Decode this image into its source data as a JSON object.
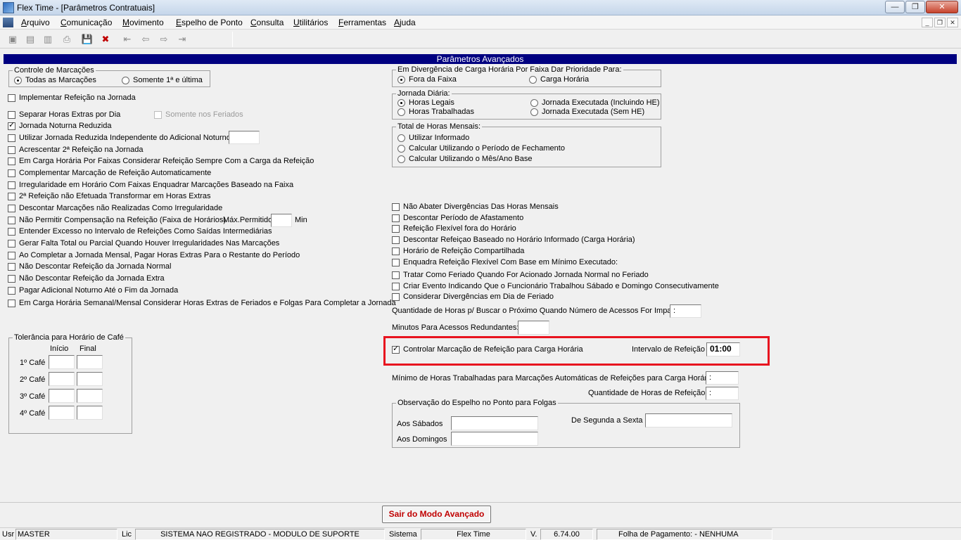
{
  "window": {
    "title": "Flex Time - [Parâmetros Contratuais]",
    "minimize": "—",
    "restore": "❐",
    "close": "✕"
  },
  "menu": {
    "items": [
      "Arquivo",
      "Comunicação",
      "Movimento",
      "Espelho de Ponto",
      "Consulta",
      "Utilitários",
      "Ferramentas",
      "Ajuda"
    ],
    "mdi_minimize": "_",
    "mdi_restore": "❐",
    "mdi_close": "✕"
  },
  "toolbar": {
    "icons": [
      "new-icon",
      "edit-icon",
      "copy-icon",
      "print-icon",
      "save-icon",
      "delete-icon",
      "first-icon",
      "previous-icon",
      "next-icon",
      "last-icon"
    ],
    "glyphs": [
      "▣",
      "▤",
      "▥",
      "⎙",
      "💾",
      "✖",
      "⇤",
      "⇦",
      "⇨",
      "⇥"
    ]
  },
  "header": {
    "title": "Parâmetros Avançados"
  },
  "controle_marcacoes": {
    "legend": "Controle de Marcações",
    "options": [
      "Todas as Marcações",
      "Somente 1ª e última"
    ],
    "selected": 0
  },
  "left_checks": [
    {
      "label": "Implementar Refeição na Jornada",
      "checked": false
    },
    {
      "label": "Separar Horas Extras por Dia",
      "checked": false
    },
    {
      "label": "Jornada Noturna Reduzida",
      "checked": true
    },
    {
      "label": "Utilizar Jornada Reduzida Independente do Adicional Noturno",
      "checked": false
    },
    {
      "label": "Acrescentar 2ª Refeição na Jornada",
      "checked": false
    },
    {
      "label": "Em Carga Horária Por Faixas Considerar Refeição Sempre Com a Carga da Refeição",
      "checked": false
    },
    {
      "label": "Complementar Marcação de Refeição Automaticamente",
      "checked": false
    },
    {
      "label": "Irregularidade em Horário Com Faixas Enquadrar Marcações Baseado na Faixa",
      "checked": false
    },
    {
      "label": "2ª Refeição não Efetuada Transformar em Horas Extras",
      "checked": false
    },
    {
      "label": "Descontar Marcações não Realizadas Como Irregularidade",
      "checked": false
    },
    {
      "label": "Não Permitir Compensação na Refeição (Faixa de Horários)",
      "checked": false
    },
    {
      "label": "Entender Excesso no Intervalo de Refeições Como Saídas Intermediárias",
      "checked": false
    },
    {
      "label": "Gerar Falta Total ou Parcial Quando Houver Irregularidades Nas Marcações",
      "checked": false
    },
    {
      "label": "Ao Completar a Jornada Mensal, Pagar Horas Extras Para o Restante do Período",
      "checked": false
    },
    {
      "label": "Não Descontar Refeição da Jornada Normal",
      "checked": false
    },
    {
      "label": "Não Descontar Refeição da Jornada Extra",
      "checked": false
    },
    {
      "label": "Pagar Adicional Noturno Até o Fim da Jornada",
      "checked": false
    },
    {
      "label": "Em Carga Horária Semanal/Mensal Considerar Horas Extras de Feriados e Folgas Para Completar a Jornada",
      "checked": false
    }
  ],
  "somente_feriados": {
    "label": "Somente nos Feriados",
    "checked": false
  },
  "max_permitido": {
    "label": "Máx.Permitido",
    "value": "",
    "unit": "Min"
  },
  "tolerancia_cafe": {
    "legend": "Tolerância para Horário de Café",
    "col_inicio": "Início",
    "col_final": "Final",
    "rows": [
      "1º Café",
      "2º Café",
      "3º Café",
      "4º Café"
    ]
  },
  "divergencia": {
    "legend": "Em Divergência de Carga Horária Por Faixa Dar Prioridade Para:",
    "options": [
      "Fora da Faixa",
      "Carga Horária"
    ],
    "selected": 0
  },
  "jornada_diaria": {
    "legend": "Jornada Diária:",
    "options": [
      "Horas Legais",
      "Horas Trabalhadas",
      "Jornada Executada (Incluindo HE)",
      "Jornada Executada (Sem HE)"
    ],
    "selected": 0
  },
  "total_horas_mensais": {
    "legend": "Total de Horas Mensais:",
    "options": [
      "Utilizar Informado",
      "Calcular Utilizando o Período de Fechamento",
      "Calcular Utilizando o Mês/Ano Base"
    ],
    "selected": -1
  },
  "right_checks": [
    {
      "label": "Não Abater Divergências Das Horas Mensais",
      "checked": false
    },
    {
      "label": "Descontar Período de Afastamento",
      "checked": false
    },
    {
      "label": "Refeição Flexível fora do Horário",
      "checked": false
    },
    {
      "label": "Descontar Refeiçao Baseado no Horário Informado (Carga Horária)",
      "checked": false
    },
    {
      "label": "Horário de Refeição Compartilhada",
      "checked": false
    },
    {
      "label": "Enquadra Refeição Flexível Com Base em Mínimo Executado:",
      "checked": false
    },
    {
      "label": "Tratar Como Feriado Quando For Acionado Jornada Normal no Feriado",
      "checked": false
    },
    {
      "label": "Criar Evento Indicando Que o Funcionário Trabalhou Sábado e Domingo Consecutivamente",
      "checked": false
    },
    {
      "label": "Considerar Divergências em Dia de Feriado",
      "checked": false
    }
  ],
  "quantidade_horas_buscar": {
    "label": "Quantidade de Horas p/ Buscar o Próximo Quando Número de Acessos For Impar",
    "value": " :"
  },
  "minutos_redundantes": {
    "label": "Minutos Para Acessos Redundantes:",
    "value": ""
  },
  "controlar_refeicao": {
    "label": "Controlar Marcação de Refeição para Carga Horária",
    "checked": true,
    "intervalo_label": "Intervalo de Refeição",
    "intervalo_value": "01:00"
  },
  "minimo_horas": {
    "label": "Mínimo de Horas Trabalhadas para Marcações Automáticas de Refeições para Carga Horária",
    "value": " :"
  },
  "quantidade_horas_refeicao": {
    "label": "Quantidade de Horas de Refeição",
    "value": " :"
  },
  "observacao": {
    "legend": "Observação do Espelho no Ponto para Folgas",
    "sabados": "Aos Sábados",
    "domingos": "Aos Domingos",
    "segunda_sexta": "De Segunda a Sexta"
  },
  "exit_button": "Sair do Modo Avançado",
  "status": {
    "usr_label": "Usr",
    "usr_value": "MASTER",
    "lic_label": "Lic",
    "lic_value": "SISTEMA NAO REGISTRADO - MODULO DE SUPORTE",
    "sistema_label": "Sistema",
    "sistema_value": "Flex Time",
    "v_label": "V.",
    "v_value": "6.74.00",
    "folha_label": "Folha de Pagamento:",
    "folha_value": "- NENHUMA"
  }
}
